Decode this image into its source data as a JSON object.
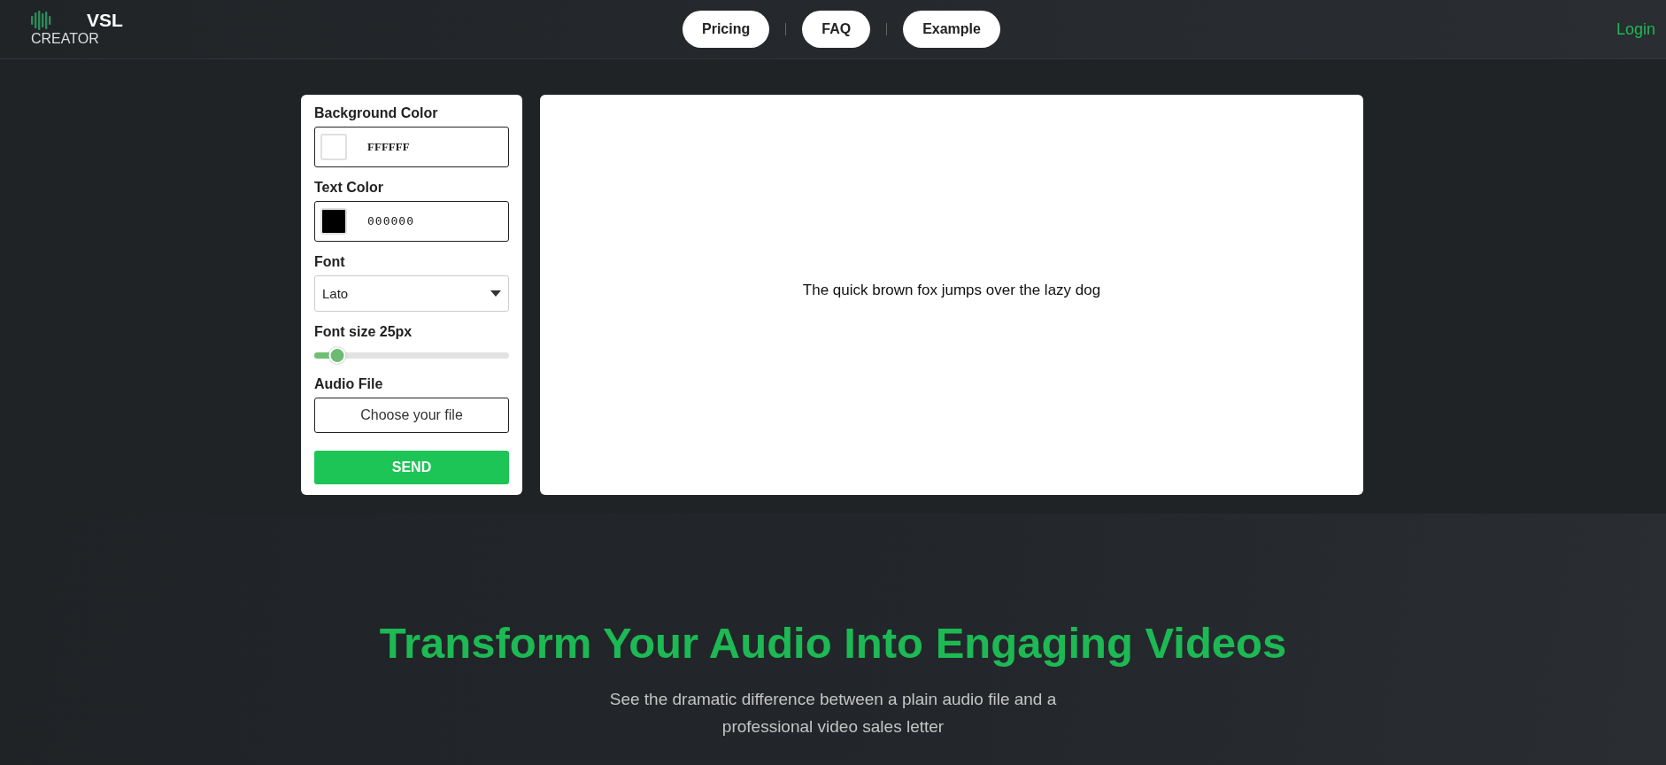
{
  "header": {
    "logo": {
      "title": "VSL",
      "subtitle": "CREATOR"
    },
    "nav": [
      {
        "label": "Pricing"
      },
      {
        "label": "FAQ"
      },
      {
        "label": "Example"
      }
    ],
    "login": "Login"
  },
  "settings": {
    "color_fields": [
      {
        "label": "Background Color",
        "value": "FFFFFF",
        "color": "#ffffff",
        "kind": "serif"
      },
      {
        "label": "Text Color",
        "value": "000000",
        "color": "#000000",
        "kind": "mono"
      }
    ],
    "font": {
      "label": "Font",
      "value": "Lato"
    },
    "font_size": {
      "label": "Font size 25px",
      "level": 0.12
    },
    "audio": {
      "label": "Audio File",
      "button": "Choose your file"
    },
    "send": "SEND"
  },
  "preview": {
    "text": "The quick brown fox jumps over the lazy dog"
  },
  "hero": {
    "title": "Transform Your Audio Into Engaging Videos",
    "subtitle": "See the dramatic difference between a plain audio file and a professional video sales letter"
  }
}
